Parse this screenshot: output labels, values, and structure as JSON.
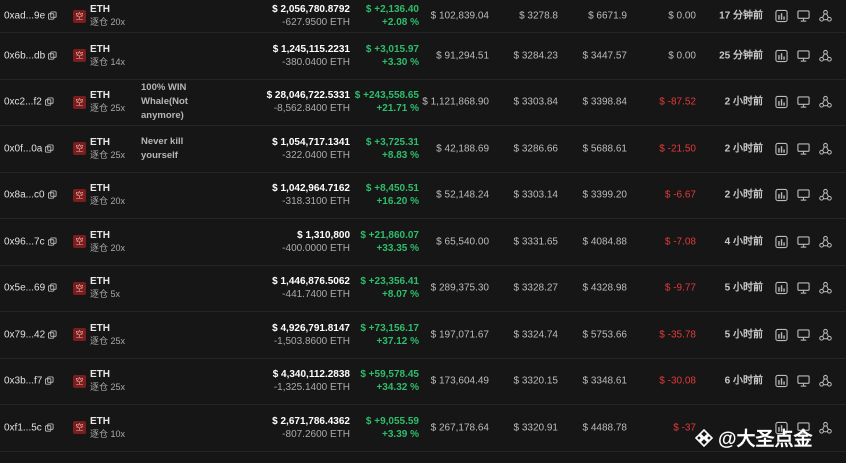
{
  "rows": [
    {
      "address": "0xad...9e",
      "coin": "ETH",
      "leverage": "逐仓 20x",
      "note": "",
      "value": "$ 2,056,780.8792",
      "size": "-627.9500 ETH",
      "pnl": "$ +2,136.40",
      "pnl_pct": "+2.08 %",
      "margin": "$ 102,839.04",
      "entry": "$ 3278.8",
      "liq": "$ 6671.9",
      "funding": "$ 0.00",
      "funding_negative": false,
      "time": "17 分钟前"
    },
    {
      "address": "0x6b...db",
      "coin": "ETH",
      "leverage": "逐仓 14x",
      "note": "",
      "value": "$ 1,245,115.2231",
      "size": "-380.0400 ETH",
      "pnl": "$ +3,015.97",
      "pnl_pct": "+3.30 %",
      "margin": "$ 91,294.51",
      "entry": "$ 3284.23",
      "liq": "$ 3447.57",
      "funding": "$ 0.00",
      "funding_negative": false,
      "time": "25 分钟前"
    },
    {
      "address": "0xc2...f2",
      "coin": "ETH",
      "leverage": "逐仓 25x",
      "note": "100% WIN Whale(Not anymore)",
      "value": "$ 28,046,722.5331",
      "size": "-8,562.8400 ETH",
      "pnl": "$ +243,558.65",
      "pnl_pct": "+21.71 %",
      "margin": "$ 1,121,868.90",
      "entry": "$ 3303.84",
      "liq": "$ 3398.84",
      "funding": "$ -87.52",
      "funding_negative": true,
      "time": "2 小时前"
    },
    {
      "address": "0x0f...0a",
      "coin": "ETH",
      "leverage": "逐仓 25x",
      "note": "Never kill yourself",
      "value": "$ 1,054,717.1341",
      "size": "-322.0400 ETH",
      "pnl": "$ +3,725.31",
      "pnl_pct": "+8.83 %",
      "margin": "$ 42,188.69",
      "entry": "$ 3286.66",
      "liq": "$ 5688.61",
      "funding": "$ -21.50",
      "funding_negative": true,
      "time": "2 小时前"
    },
    {
      "address": "0x8a...c0",
      "coin": "ETH",
      "leverage": "逐仓 20x",
      "note": "",
      "value": "$ 1,042,964.7162",
      "size": "-318.3100 ETH",
      "pnl": "$ +8,450.51",
      "pnl_pct": "+16.20 %",
      "margin": "$ 52,148.24",
      "entry": "$ 3303.14",
      "liq": "$ 3399.20",
      "funding": "$ -6.67",
      "funding_negative": true,
      "time": "2 小时前"
    },
    {
      "address": "0x96...7c",
      "coin": "ETH",
      "leverage": "逐仓 20x",
      "note": "",
      "value": "$ 1,310,800",
      "size": "-400.0000 ETH",
      "pnl": "$ +21,860.07",
      "pnl_pct": "+33.35 %",
      "margin": "$ 65,540.00",
      "entry": "$ 3331.65",
      "liq": "$ 4084.88",
      "funding": "$ -7.08",
      "funding_negative": true,
      "time": "4 小时前"
    },
    {
      "address": "0x5e...69",
      "coin": "ETH",
      "leverage": "逐仓 5x",
      "note": "",
      "value": "$ 1,446,876.5062",
      "size": "-441.7400 ETH",
      "pnl": "$ +23,356.41",
      "pnl_pct": "+8.07 %",
      "margin": "$ 289,375.30",
      "entry": "$ 3328.27",
      "liq": "$ 4328.98",
      "funding": "$ -9.77",
      "funding_negative": true,
      "time": "5 小时前"
    },
    {
      "address": "0x79...42",
      "coin": "ETH",
      "leverage": "逐仓 25x",
      "note": "",
      "value": "$ 4,926,791.8147",
      "size": "-1,503.8600 ETH",
      "pnl": "$ +73,156.17",
      "pnl_pct": "+37.12 %",
      "margin": "$ 197,071.67",
      "entry": "$ 3324.74",
      "liq": "$ 5753.66",
      "funding": "$ -35.78",
      "funding_negative": true,
      "time": "5 小时前"
    },
    {
      "address": "0x3b...f7",
      "coin": "ETH",
      "leverage": "逐仓 25x",
      "note": "",
      "value": "$ 4,340,112.2838",
      "size": "-1,325.1400 ETH",
      "pnl": "$ +59,578.45",
      "pnl_pct": "+34.32 %",
      "margin": "$ 173,604.49",
      "entry": "$ 3320.15",
      "liq": "$ 3348.61",
      "funding": "$ -30.08",
      "funding_negative": true,
      "time": "6 小时前"
    },
    {
      "address": "0xf1...5c",
      "coin": "ETH",
      "leverage": "逐仓 10x",
      "note": "",
      "value": "$ 2,671,786.4362",
      "size": "-807.2600 ETH",
      "pnl": "$ +9,055.59",
      "pnl_pct": "+3.39 %",
      "margin": "$ 267,178.64",
      "entry": "$ 3320.91",
      "liq": "$ 4488.78",
      "funding": "$ -37",
      "funding_negative": true,
      "time": ""
    }
  ],
  "side_badge": "空",
  "watermark": "@大圣点金",
  "icons": [
    "copy-icon",
    "chart-icon",
    "monitor-icon",
    "share-icon",
    "binance-logo-icon"
  ],
  "colors": {
    "positive": "#2ebd6b",
    "negative": "#e23a3a",
    "short_badge": "#7a1d1d",
    "background": "#161616"
  }
}
